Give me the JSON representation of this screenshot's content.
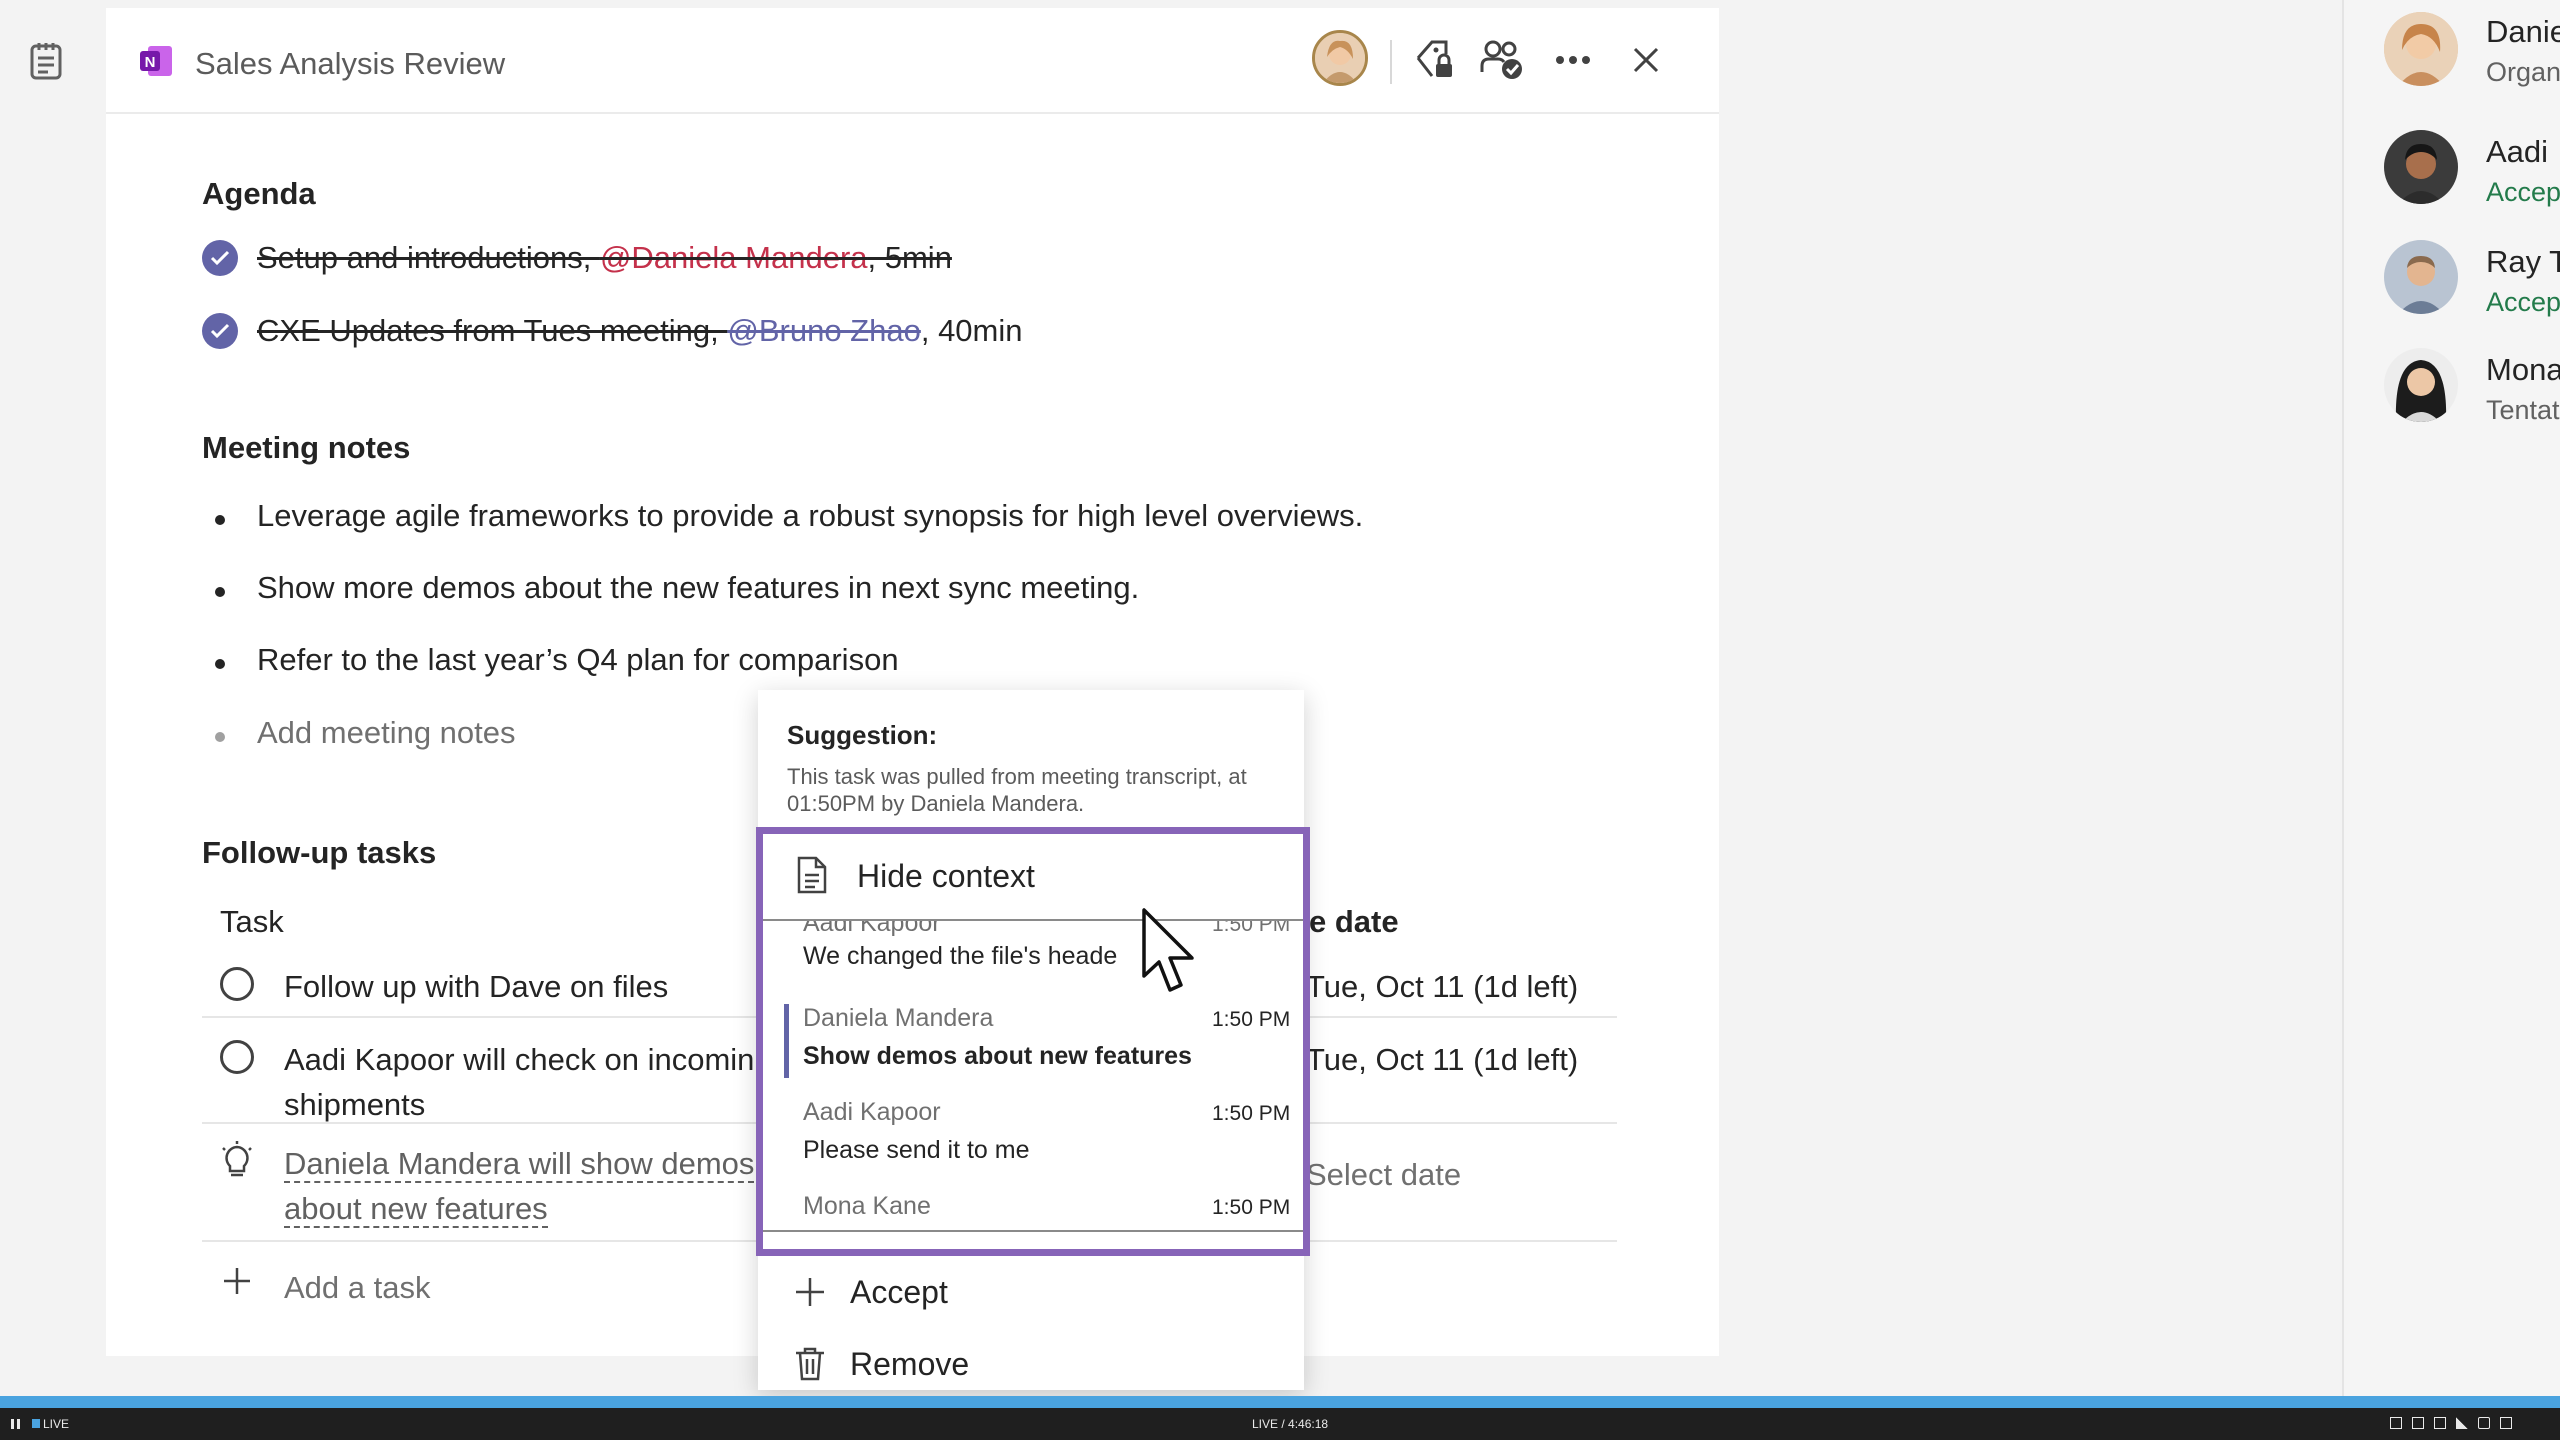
{
  "header": {
    "title": "Sales Analysis Review",
    "icons": [
      "onenote-logo-icon",
      "avatar",
      "tag-lock-icon",
      "people-check-icon",
      "more-icon",
      "close-icon"
    ]
  },
  "agenda": {
    "heading": "Agenda",
    "items": [
      {
        "text_before": "Setup and introductions, ",
        "mention": "@Daniela Mandera",
        "text_after": ", 5min",
        "mention_color": "#c4314b"
      },
      {
        "text_before": "CXE Updates from Tues meeting, ",
        "mention": "@Bruno Zhao",
        "text_after": ", 40min",
        "mention_color": "#6264a7"
      }
    ]
  },
  "notes": {
    "heading": "Meeting notes",
    "items": [
      "Leverage agile frameworks to provide a robust synopsis for high level overviews.",
      "Show more demos about the new features in next sync meeting.",
      "Refer to the last year’s Q4 plan for comparison"
    ],
    "placeholder": "Add meeting notes"
  },
  "tasks": {
    "heading": "Follow-up tasks",
    "col_task": "Task",
    "col_date_fragment": "e date",
    "rows": [
      {
        "task": "Follow up with Dave on files",
        "date": "Tue, Oct 11 (1d left)"
      },
      {
        "task": "Aadi Kapoor will check on incomin",
        "task_line2": "shipments",
        "date": "Tue, Oct 11 (1d left)"
      },
      {
        "task": "Daniela Mandera will show demos",
        "task_line2": "about new features",
        "date": "Select date",
        "suggested": true
      }
    ],
    "add_label": "Add a task"
  },
  "popup": {
    "heading": "Suggestion:",
    "desc_line1": "This task was pulled from meeting transcript, at",
    "desc_line2": "01:50PM by Daniela Mandera.",
    "hide_context_label": "Hide context",
    "transcript": [
      {
        "speaker": "Aadi Kapoor",
        "time": "1:50 PM",
        "text": "We changed the file's heade"
      },
      {
        "speaker": "Daniela Mandera",
        "time": "1:50 PM",
        "text": "Show demos about new features",
        "highlight": true
      },
      {
        "speaker": "Aadi Kapoor",
        "time": "1:50 PM",
        "text": "Please send it to me"
      },
      {
        "speaker": "Mona Kane",
        "time": "1:50 PM",
        "text": ""
      }
    ],
    "accept_label": "Accept",
    "remove_label": "Remove",
    "accent_color": "#8764b8"
  },
  "participants": [
    {
      "name": "Danie",
      "status": "Organ",
      "status_color": "#616161"
    },
    {
      "name": "Aadi",
      "status": "Accept",
      "status_color": "#237b4b"
    },
    {
      "name": "Ray T",
      "status": "Accept",
      "status_color": "#237b4b"
    },
    {
      "name": "Mona",
      "status": "Tentat",
      "status_color": "#616161"
    }
  ],
  "status_bar": {
    "left_label": "LIVE",
    "center_label": "LIVE / 4:46:18"
  },
  "colors": {
    "brand": "#6264a7",
    "accent_bar": "#4aa3df"
  }
}
